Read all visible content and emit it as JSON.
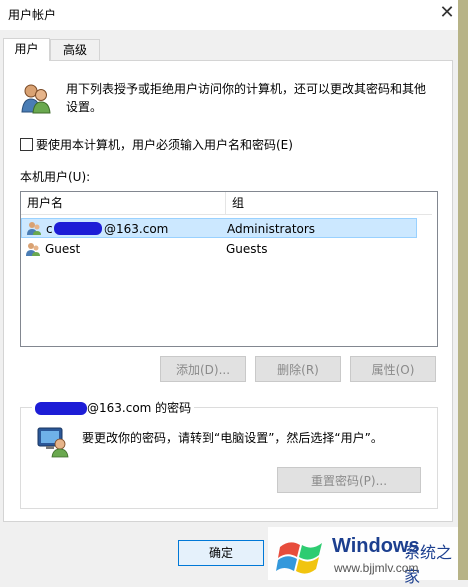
{
  "window": {
    "title": "用户帐户",
    "close_glyph": "✕"
  },
  "tabs": [
    {
      "label": "用户"
    },
    {
      "label": "高级"
    }
  ],
  "description": "用下列表授予或拒绝用户访问你的计算机，还可以更改其密码和其他设置。",
  "checkbox": {
    "label": "要使用本计算机，用户必须输入用户名和密码(E)"
  },
  "users_label": "本机用户(U):",
  "table": {
    "headers": [
      "用户名",
      "组"
    ],
    "rows": [
      {
        "name_prefix": "c",
        "name_suffix": "@163.com",
        "group": "Administrators"
      },
      {
        "name_prefix": "",
        "name_suffix": "Guest",
        "group": "Guests"
      }
    ]
  },
  "buttons": {
    "add": "添加(D)...",
    "remove": "删除(R)",
    "properties": "属性(O)",
    "reset_password": "重置密码(P)...",
    "ok": "确定"
  },
  "password_group": {
    "title_suffix": "@163.com 的密码",
    "text": "要更改你的密码，请转到“电脑设置”，然后选择“用户”。"
  },
  "watermark": {
    "brand": "Windows",
    "cn": "系统之家",
    "url": "www.bjjmlv.com"
  },
  "colors": {
    "selection": "#cce8ff",
    "accent": "#0078d7",
    "redaction": "#1d1dd6"
  }
}
